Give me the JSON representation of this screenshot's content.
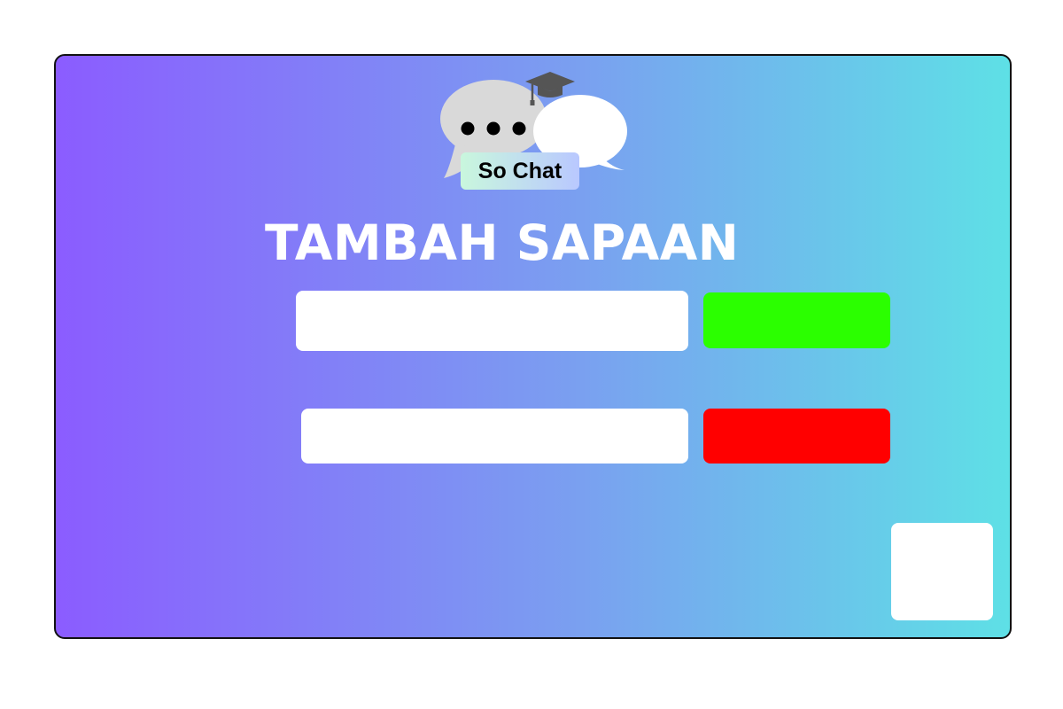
{
  "logo": {
    "label": "So Chat",
    "icon": "chat-bubbles-graduation-cap-icon"
  },
  "page": {
    "title": "TAMBAH SAPAAN"
  },
  "form": {
    "greeting_input": {
      "value": "",
      "placeholder": ""
    },
    "add_button_label": "",
    "delete_input": {
      "value": "",
      "placeholder": ""
    },
    "delete_button_label": ""
  },
  "colors": {
    "gradient_start": "#8b5cff",
    "gradient_mid": "#7aa0f0",
    "gradient_end": "#5ee0e6",
    "add_button": "#2bff00",
    "delete_button": "#ff0000",
    "title_text": "#ffffff",
    "bubble_gray": "#d9d9d9",
    "bubble_white": "#ffffff",
    "cap": "#555555"
  }
}
